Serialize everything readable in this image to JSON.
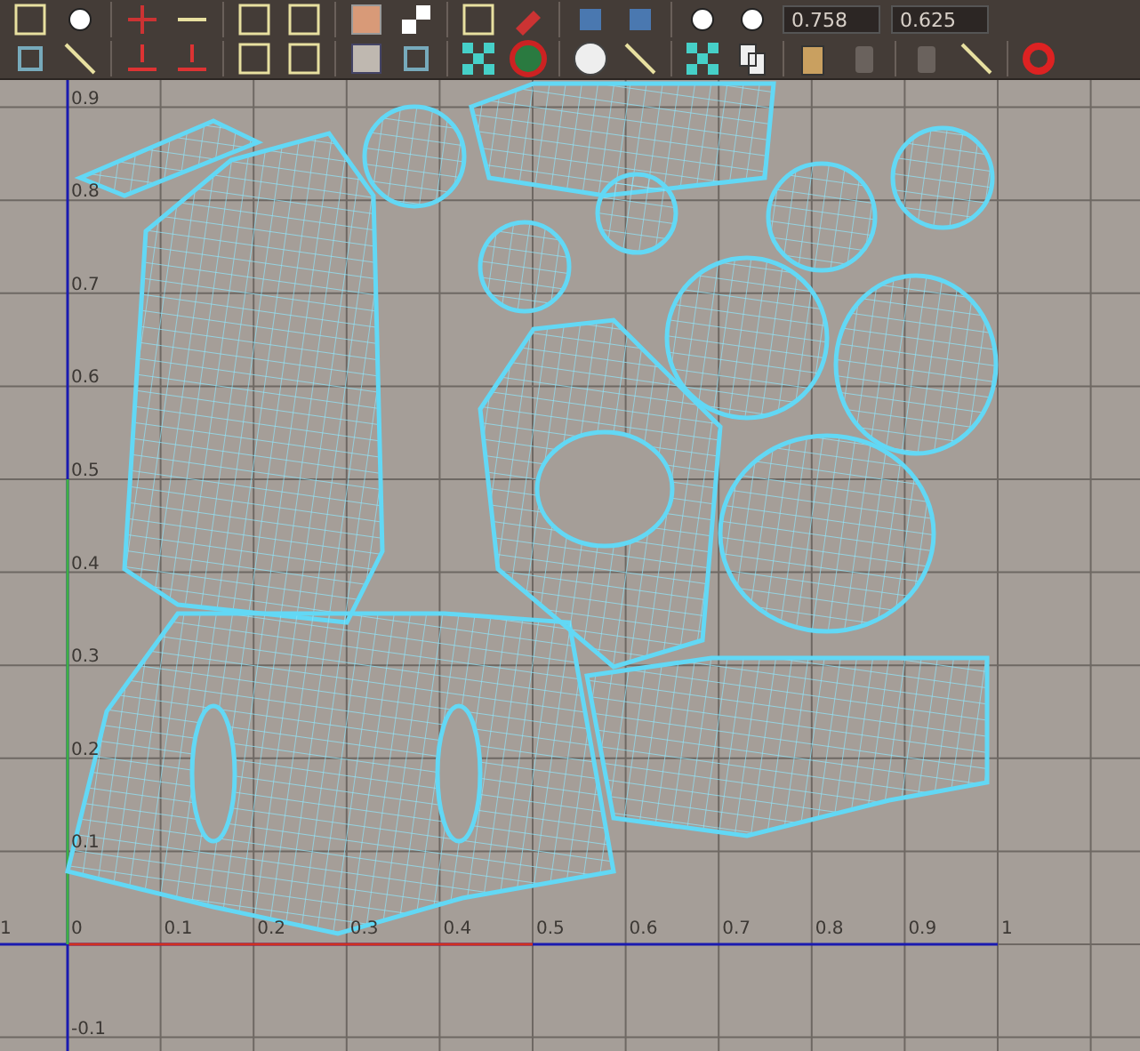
{
  "toolbar": {
    "fields": [
      {
        "value": "0.758"
      },
      {
        "value": "0.625"
      }
    ]
  },
  "uv_editor": {
    "v_labels": [
      "0.9",
      "0.8",
      "0.7",
      "0.6",
      "0.5",
      "0.4",
      "0.3",
      "0.2",
      "0.1",
      "-0.1"
    ],
    "u_labels": [
      "1",
      "0",
      "0.1",
      "0.2",
      "0.3",
      "0.4",
      "0.5",
      "0.6",
      "0.7",
      "0.8",
      "0.9",
      "1"
    ]
  }
}
